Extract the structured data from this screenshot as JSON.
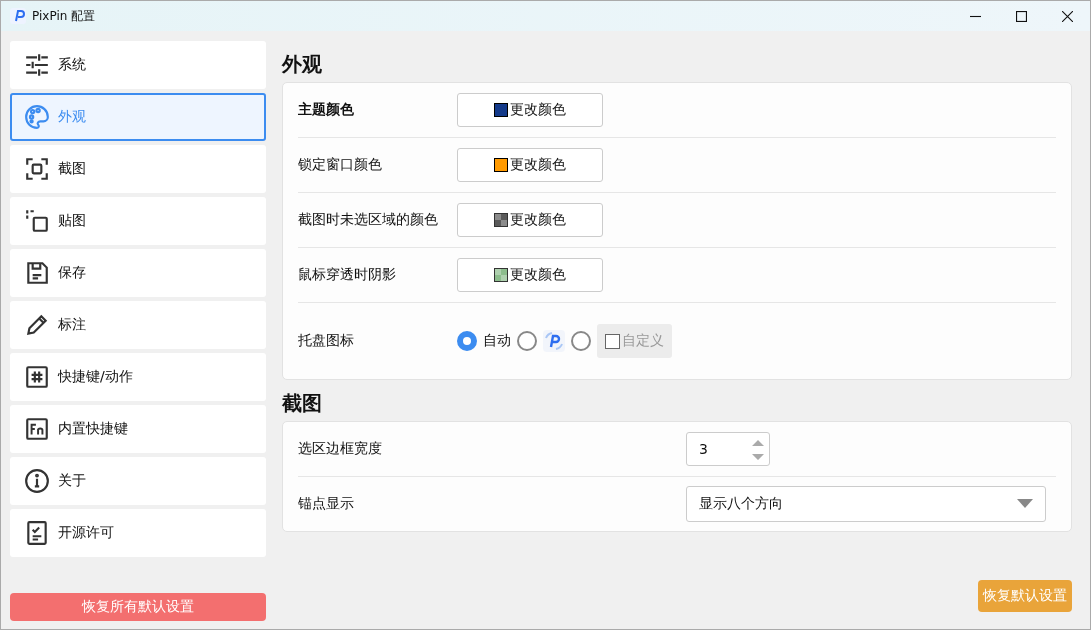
{
  "window": {
    "title": "PixPin 配置"
  },
  "sidebar": {
    "items": [
      {
        "label": "系统",
        "selected": false
      },
      {
        "label": "外观",
        "selected": true
      },
      {
        "label": "截图",
        "selected": false
      },
      {
        "label": "贴图",
        "selected": false
      },
      {
        "label": "保存",
        "selected": false
      },
      {
        "label": "标注",
        "selected": false
      },
      {
        "label": "快捷键/动作",
        "selected": false
      },
      {
        "label": "内置快捷键",
        "selected": false
      },
      {
        "label": "关于",
        "selected": false
      },
      {
        "label": "开源许可",
        "selected": false
      }
    ],
    "reset_all_button": "恢复所有默认设置"
  },
  "appearance": {
    "heading": "外观",
    "color_rows": [
      {
        "label": "主题颜色",
        "bold": true,
        "kind": "solid",
        "color": "#143a8a",
        "button": "更改颜色"
      },
      {
        "label": "锁定窗口颜色",
        "bold": false,
        "kind": "solid",
        "color": "#ff9a00",
        "button": "更改颜色"
      },
      {
        "label": "截图时未选区域的颜色",
        "bold": false,
        "kind": "checker",
        "color": "#5a5a5a",
        "button": "更改颜色"
      },
      {
        "label": "鼠标穿透时阴影",
        "bold": false,
        "kind": "checker",
        "color": "#8cbc8c",
        "button": "更改颜色"
      }
    ],
    "tray_icon": {
      "label": "托盘图标",
      "options": [
        {
          "kind": "text",
          "label": "自动",
          "selected": true
        },
        {
          "kind": "logo",
          "selected": false
        },
        {
          "kind": "custom",
          "selected": false,
          "label": "自定义",
          "checked": false,
          "disabled": true
        }
      ]
    }
  },
  "screenshot": {
    "heading": "截图",
    "border_width": {
      "label": "选区边框宽度",
      "value": "3"
    },
    "anchor_display": {
      "label": "锚点显示",
      "value": "显示八个方向"
    }
  },
  "reset_button": "恢复默认设置"
}
